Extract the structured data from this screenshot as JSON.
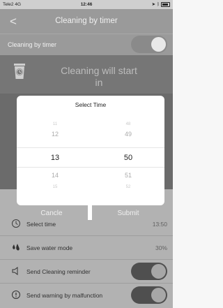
{
  "status": {
    "carrier": "Tele2",
    "network": "4G",
    "time": "12:46"
  },
  "nav": {
    "title": "Cleaning by timer",
    "back_glyph": "<"
  },
  "main_toggle": {
    "label": "Cleaning by timer",
    "on": true
  },
  "hero": {
    "message": "Cleaning will start in"
  },
  "dialog": {
    "title": "Select Time",
    "hours": [
      "11",
      "12",
      "13",
      "14",
      "15"
    ],
    "minutes": [
      "48",
      "49",
      "50",
      "51",
      "52"
    ],
    "selected_hour": "13",
    "selected_minute": "50",
    "cancel_label": "Cancle",
    "submit_label": "Submit"
  },
  "settings": [
    {
      "icon": "clock-icon",
      "label": "Select time",
      "value": "13:50"
    },
    {
      "icon": "water-drop-icon",
      "label": "Save water mode",
      "value": "30%"
    },
    {
      "icon": "speaker-icon",
      "label": "Send Cleaning reminder",
      "toggle": true
    },
    {
      "icon": "warning-icon",
      "label": "Send warning by malfunction",
      "toggle": true
    }
  ],
  "colors": {
    "overlay": "#6b6b6b",
    "dialog_bg": "#ffffff",
    "nav": "#9a9a9a"
  }
}
